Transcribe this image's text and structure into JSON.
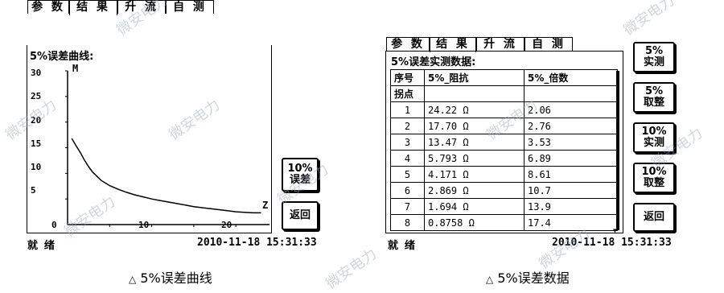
{
  "left_screen": {
    "tabs": [
      "参 数",
      "结 果",
      "升 流",
      "自 测"
    ],
    "active_tab": 1,
    "title": "5%误差曲线:",
    "y_axis_label": "M",
    "x_axis_label": "Z",
    "button_10pct_error": [
      "10%",
      "误差"
    ],
    "button_back": "返回",
    "status": "就 绪",
    "datetime": "2010-11-18  15:31:33"
  },
  "chart_data": {
    "type": "line",
    "title": "5%误差曲线:",
    "xlabel": "Z",
    "ylabel": "M",
    "xlim": [
      0,
      24
    ],
    "ylim": [
      0,
      30
    ],
    "x_ticks": [
      "10",
      "20"
    ],
    "y_ticks": [
      "30",
      "25",
      "20",
      "15",
      "10",
      "5",
      "0"
    ],
    "series": [
      {
        "x": [
          0.5,
          1,
          1.5,
          2,
          2.5,
          3,
          4,
          5,
          6,
          7,
          8,
          9,
          10,
          11,
          12,
          13,
          14,
          15,
          16,
          17,
          18,
          19,
          20,
          21,
          22,
          23
        ],
        "y": [
          16.8,
          15.4,
          14.1,
          12.6,
          11.3,
          10.2,
          8.6,
          7.6,
          6.9,
          6.3,
          5.8,
          5.4,
          5.0,
          4.7,
          4.4,
          4.1,
          3.8,
          3.5,
          3.3,
          3.1,
          2.9,
          2.7,
          2.5,
          2.4,
          2.3,
          2.3
        ]
      }
    ]
  },
  "right_screen": {
    "tabs": [
      "参 数",
      "结 果",
      "升 流",
      "自 测"
    ],
    "active_tab": 1,
    "title": "5%误差实测数据:",
    "table_headers": [
      "序号",
      "5%_阻抗",
      "5%_倍数"
    ],
    "table_rows": [
      [
        "拐点",
        "",
        ""
      ],
      [
        "1",
        "24.22 Ω",
        "2.06"
      ],
      [
        "2",
        "17.70 Ω",
        "2.76"
      ],
      [
        "3",
        "13.47 Ω",
        "3.53"
      ],
      [
        "4",
        "5.793 Ω",
        "6.89"
      ],
      [
        "5",
        "4.171 Ω",
        "8.61"
      ],
      [
        "6",
        "2.869 Ω",
        "10.7"
      ],
      [
        "7",
        "1.694 Ω",
        "13.9"
      ],
      [
        "8",
        "0.8758 Ω",
        "17.4"
      ]
    ],
    "buttons": [
      [
        "5%",
        "实测"
      ],
      [
        "5%",
        "取整"
      ],
      [
        "10%",
        "实测"
      ],
      [
        "10%",
        "取整"
      ],
      [
        "返回"
      ]
    ],
    "status": "就 绪",
    "datetime": "2010-11-18  15:31:33"
  },
  "captions": [
    "5%误差曲线",
    "5%误差数据"
  ],
  "watermark": "微安电力"
}
